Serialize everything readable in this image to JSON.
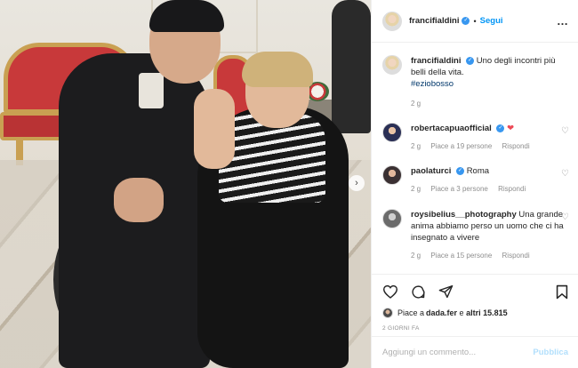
{
  "post": {
    "username": "francifialdini",
    "follow_label": "Segui",
    "separator": "•",
    "more_icon": "…"
  },
  "caption": {
    "username": "francifialdini",
    "text": "Uno degli incontri più belli della vita.",
    "hashtag": "#eziobosso",
    "time": "2 g"
  },
  "comments": [
    {
      "username": "robertacapuaofficial",
      "text": "",
      "emoji": "❤",
      "time": "2 g",
      "likes": "Piace a 19 persone",
      "reply": "Rispondi"
    },
    {
      "username": "paolaturci",
      "text": "Roma",
      "time": "2 g",
      "likes": "Piace a 3 persone",
      "reply": "Rispondi"
    },
    {
      "username": "roysibelius__photography",
      "text": "Una grande anima abbiamo perso un uomo che ci ha insegnato a vivere",
      "time": "2 g",
      "likes": "Piace a 15 persone",
      "reply": "Rispondi"
    }
  ],
  "likes": {
    "prefix": "Piace a ",
    "user": "dada.fer",
    "middle": " e ",
    "others": "altri 15.815"
  },
  "date_label": "2 GIORNI FA",
  "add_comment": {
    "placeholder": "Aggiungi un commento...",
    "publish_label": "Pubblica"
  },
  "colors": {
    "accent": "#0095f6",
    "verified": "#3897f0",
    "heart": "#ed4956"
  },
  "icons": {
    "like": "heart-icon",
    "comment": "comment-icon",
    "share": "share-icon",
    "save": "bookmark-icon",
    "next": "chevron-right-icon"
  }
}
